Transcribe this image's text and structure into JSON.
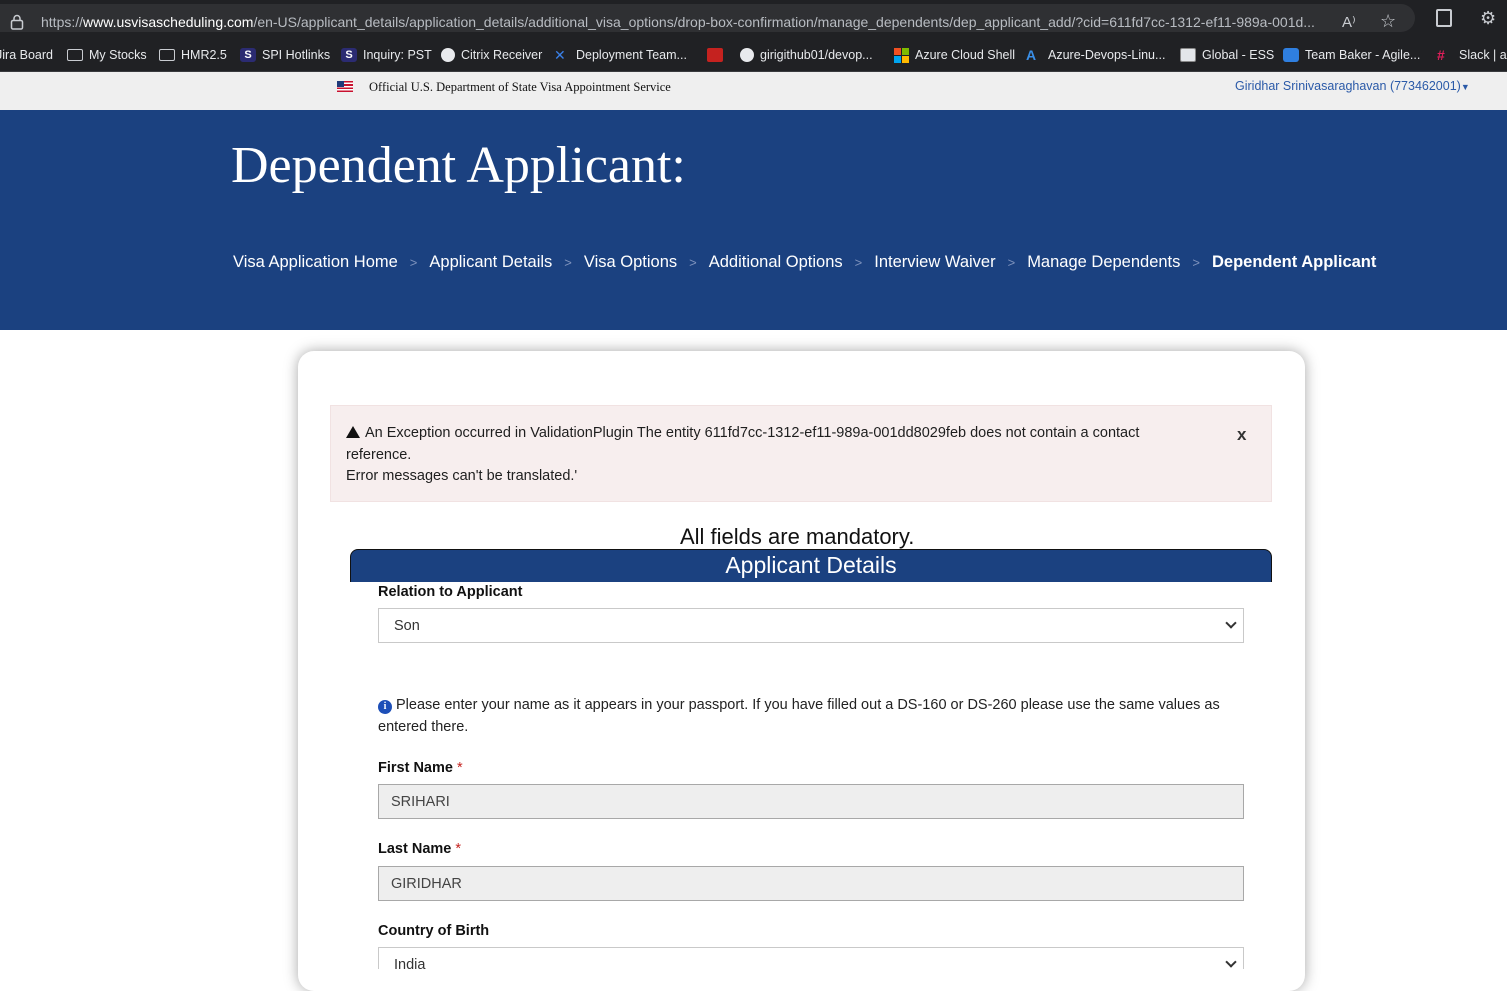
{
  "browser": {
    "url_prefix": "https://",
    "url_domain": "www.usvisascheduling.com",
    "url_path": "/en-US/applicant_details/application_details/additional_visa_options/drop-box-confirmation/manage_dependents/dep_applicant_add/?cid=611fd7cc-1312-ef11-989a-001d...",
    "bookmarks": [
      {
        "label": "Jira Board",
        "icon": "none"
      },
      {
        "label": "My Stocks",
        "icon": "folder-icon"
      },
      {
        "label": "HMR2.5",
        "icon": "folder-icon"
      },
      {
        "label": "SPI Hotlinks",
        "icon": "s-icon"
      },
      {
        "label": "Inquiry: PST",
        "icon": "s-icon"
      },
      {
        "label": "Citrix Receiver",
        "icon": "citrix-icon"
      },
      {
        "label": "Deployment Team...",
        "icon": "deployment-icon"
      },
      {
        "label": "",
        "icon": "pdf-icon"
      },
      {
        "label": "girigithub01/devop...",
        "icon": "github-icon"
      },
      {
        "label": "Azure Cloud Shell",
        "icon": "microsoft-icon"
      },
      {
        "label": "Azure-Devops-Linu...",
        "icon": "azure-icon"
      },
      {
        "label": "Global - ESS",
        "icon": "global-icon"
      },
      {
        "label": "Team Baker - Agile...",
        "icon": "teams-icon"
      },
      {
        "label": "Slack | ale",
        "icon": "slack-icon"
      }
    ]
  },
  "site": {
    "official_text": "Official U.S. Department of State Visa Appointment Service",
    "user_name": "Giridhar Srinivasaraghavan (773462001)"
  },
  "header": {
    "title": "Dependent Applicant:",
    "breadcrumbs": [
      "Visa Application Home",
      "Applicant Details",
      "Visa Options",
      "Additional Options",
      "Interview Waiver",
      "Manage Dependents",
      "Dependent Applicant"
    ],
    "separator": ">"
  },
  "alert": {
    "line1": "An Exception occurred in ValidationPlugin The entity 611fd7cc-1312-ef11-989a-001dd8029feb does not contain a contact reference.",
    "line2": "Error messages can't be translated.'",
    "close_label": "x"
  },
  "form": {
    "mandatory_note": "All fields are mandatory.",
    "section_title": "Applicant Details",
    "relation_label": "Relation to Applicant",
    "relation_value": "Son",
    "info_text": "Please enter your name as it appears in your passport. If you have filled out a DS-160 or DS-260 please use the same values as entered there.",
    "first_name_label": "First Name",
    "first_name_value": "SRIHARI",
    "last_name_label": "Last Name",
    "last_name_value": "GIRIDHAR",
    "country_label": "Country of Birth",
    "country_value": "India",
    "required_mark": "*"
  },
  "colors": {
    "header_blue": "#1b4180",
    "alert_bg": "#f7eeee",
    "required_red": "#c5221f"
  }
}
